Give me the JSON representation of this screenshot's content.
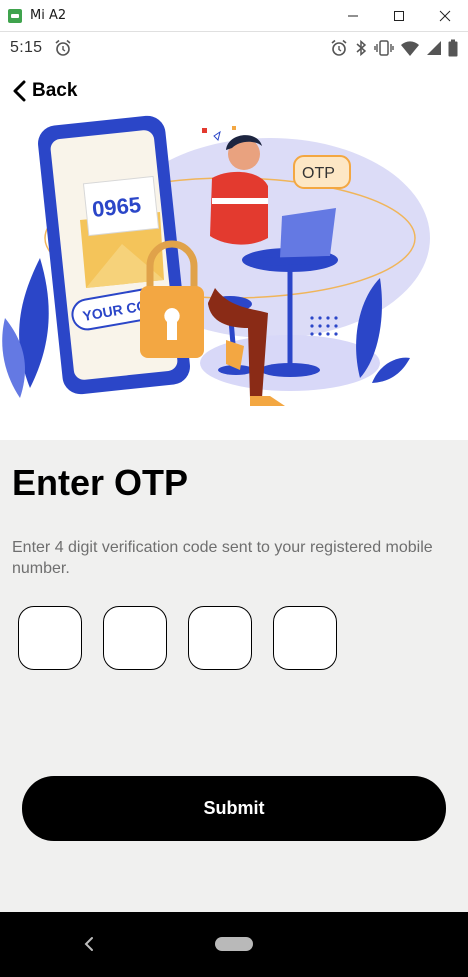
{
  "window": {
    "title": "Mi A2"
  },
  "status_bar": {
    "time": "5:15",
    "icons": [
      "alarm-icon",
      "bluetooth-icon",
      "vibrate-icon",
      "wifi-icon",
      "signal-icon",
      "battery-icon"
    ]
  },
  "header": {
    "back_label": "Back"
  },
  "illustration": {
    "code_text": "0965",
    "badge_text": "OTP",
    "card_text": "YOUR CODE"
  },
  "main": {
    "title": "Enter OTP",
    "description": "Enter 4 digit verification code sent to your registered mobile number.",
    "otp_digits": [
      "",
      "",
      "",
      ""
    ],
    "submit_label": "Submit"
  },
  "colors": {
    "accent": "#000000",
    "background": "#f0f0ef",
    "illustration_blue": "#2b46c8",
    "illustration_orange": "#f3a742"
  }
}
